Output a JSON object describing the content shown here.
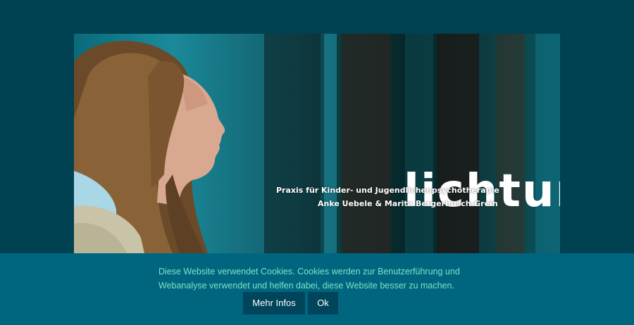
{
  "hero": {
    "logo_word": "lichtung",
    "tagline": "Praxis für Kinder- und Jugendlichenpsychotherapie",
    "names": "Anke Uebele & Marita Bergerbusch-Grein"
  },
  "cookie_banner": {
    "line1": "Diese Website verwendet Cookies. Cookies werden zur Benutzerführung und",
    "line2": "Webanalyse verwendet und helfen dabei, diese Website besser zu machen.",
    "more_label": "Mehr Infos",
    "ok_label": "Ok"
  },
  "colors": {
    "page_bg": "#004152",
    "banner_bg": "#006680",
    "banner_text": "#7fe0c4",
    "button_bg": "#00455a"
  }
}
